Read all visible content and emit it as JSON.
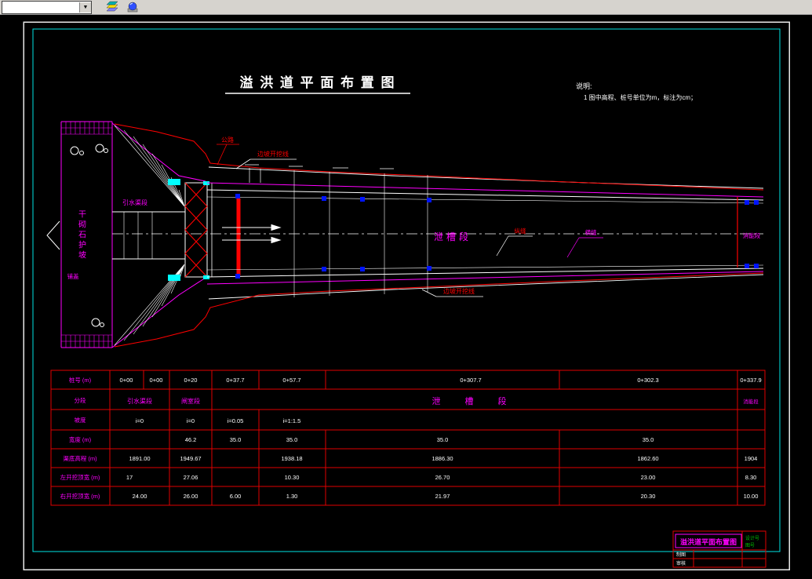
{
  "toolbar": {
    "combo_value": ""
  },
  "drawing": {
    "main_title": "溢 洪 道 平 面 布 置 图",
    "notes_heading": "说明:",
    "notes_item1": "1  图中高程、桩号单位为m，标注为cm；",
    "labels": {
      "road": "公路",
      "slope_excavation": "边坡开挖线",
      "intake_segment": "引水渠段",
      "dry_masonry_slope": "干砌石护坡",
      "apron": "铺盖",
      "chute_segment": "泄槽段",
      "longitudinal_joint": "纵缝",
      "transverse_joint": "横缝",
      "energy_segment": "消能段"
    }
  },
  "table": {
    "row_labels": [
      "桩号 (m)",
      "分段",
      "坡度",
      "宽度 (m)",
      "渠底高程 (m)",
      "左开挖顶宽 (m)",
      "右开挖顶宽 (m)"
    ],
    "stations": [
      "0+00",
      "0+00",
      "0+20",
      "0+37.7",
      "0+57.7",
      "0+307.7",
      "0+302.3",
      "0+337.9"
    ],
    "segments": [
      "引水渠段",
      "闸室段",
      "泄  槽  段",
      "消能段"
    ],
    "slopes": [
      "i=0",
      "i=0",
      "i=0.05",
      "i=1:1.5"
    ],
    "widths": [
      "46.2",
      "35.0",
      "35.0",
      "35.0",
      "35.0"
    ],
    "elevations": [
      "1891.00",
      "1949.67",
      "1938.18",
      "1886.30",
      "1862.60",
      "1904"
    ],
    "left_top_widths": [
      "17",
      "27.06",
      "10.30",
      "26.70",
      "23.00",
      "8.30"
    ],
    "right_top_widths": [
      "24.00",
      "26.00",
      "6.00",
      "1.30",
      "21.97",
      "20.30",
      "10.00"
    ]
  },
  "title_block": {
    "name": "溢洪道平面布置图",
    "drafter_label": "制图",
    "reviewer_label": "审核",
    "design_no_label": "设计号",
    "drawing_no_label": "图号"
  },
  "colors": {
    "magenta": "#FF00FF",
    "red": "#FF0000",
    "cyan": "#00FFFF",
    "blue": "#0014FF",
    "white": "#FFFFFF",
    "green": "#00C000",
    "table_line": "#E00000",
    "background": "#000000"
  }
}
